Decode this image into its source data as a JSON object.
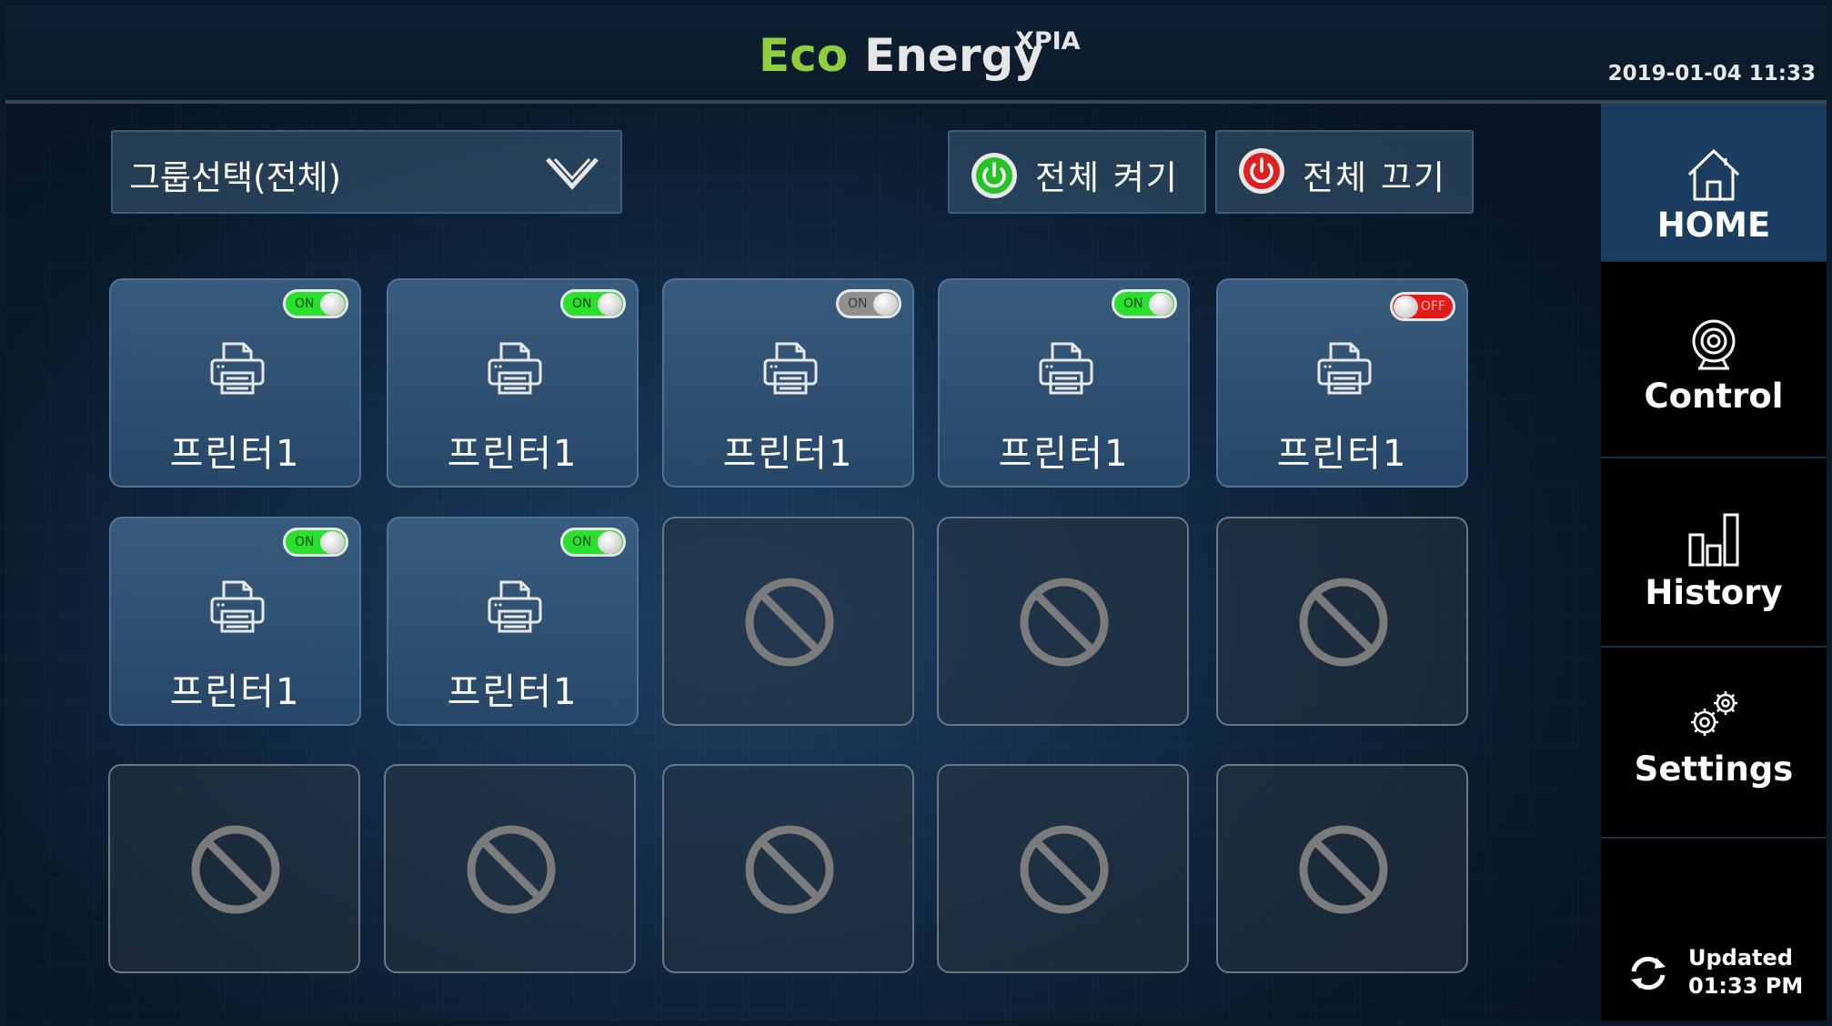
{
  "app": {
    "title_eco": "Eco",
    "title_energy": "Energy",
    "title_sup": "XPIA",
    "datetime": "2019-01-04 11:33"
  },
  "toolbar": {
    "group_select_label": "그룹선택(전체)",
    "all_on_label": "전체 켜기",
    "all_off_label": "전체 끄기"
  },
  "nav": {
    "items": [
      {
        "label": "HOME",
        "icon": "home-icon",
        "active": true
      },
      {
        "label": "Control",
        "icon": "webcam-icon",
        "active": false
      },
      {
        "label": "History",
        "icon": "bar-chart-icon",
        "active": false
      },
      {
        "label": "Settings",
        "icon": "gears-icon",
        "active": false
      }
    ],
    "updated_label": "Updated",
    "updated_time": "01:33 PM"
  },
  "devices": [
    {
      "name": "프린터1",
      "toggle": "ON",
      "state": "on"
    },
    {
      "name": "프린터1",
      "toggle": "ON",
      "state": "on"
    },
    {
      "name": "프린터1",
      "toggle": "ON",
      "state": "dim"
    },
    {
      "name": "프린터1",
      "toggle": "ON",
      "state": "on"
    },
    {
      "name": "프린터1",
      "toggle": "OFF",
      "state": "off"
    },
    {
      "name": "프린터1",
      "toggle": "ON",
      "state": "on"
    },
    {
      "name": "프린터1",
      "toggle": "ON",
      "state": "on"
    }
  ],
  "colors": {
    "eco_green": "#8fcf3c",
    "toggle_on": "#29e02c",
    "toggle_off": "#e11a1a",
    "power_on": "#27c227",
    "power_off": "#e02020"
  }
}
